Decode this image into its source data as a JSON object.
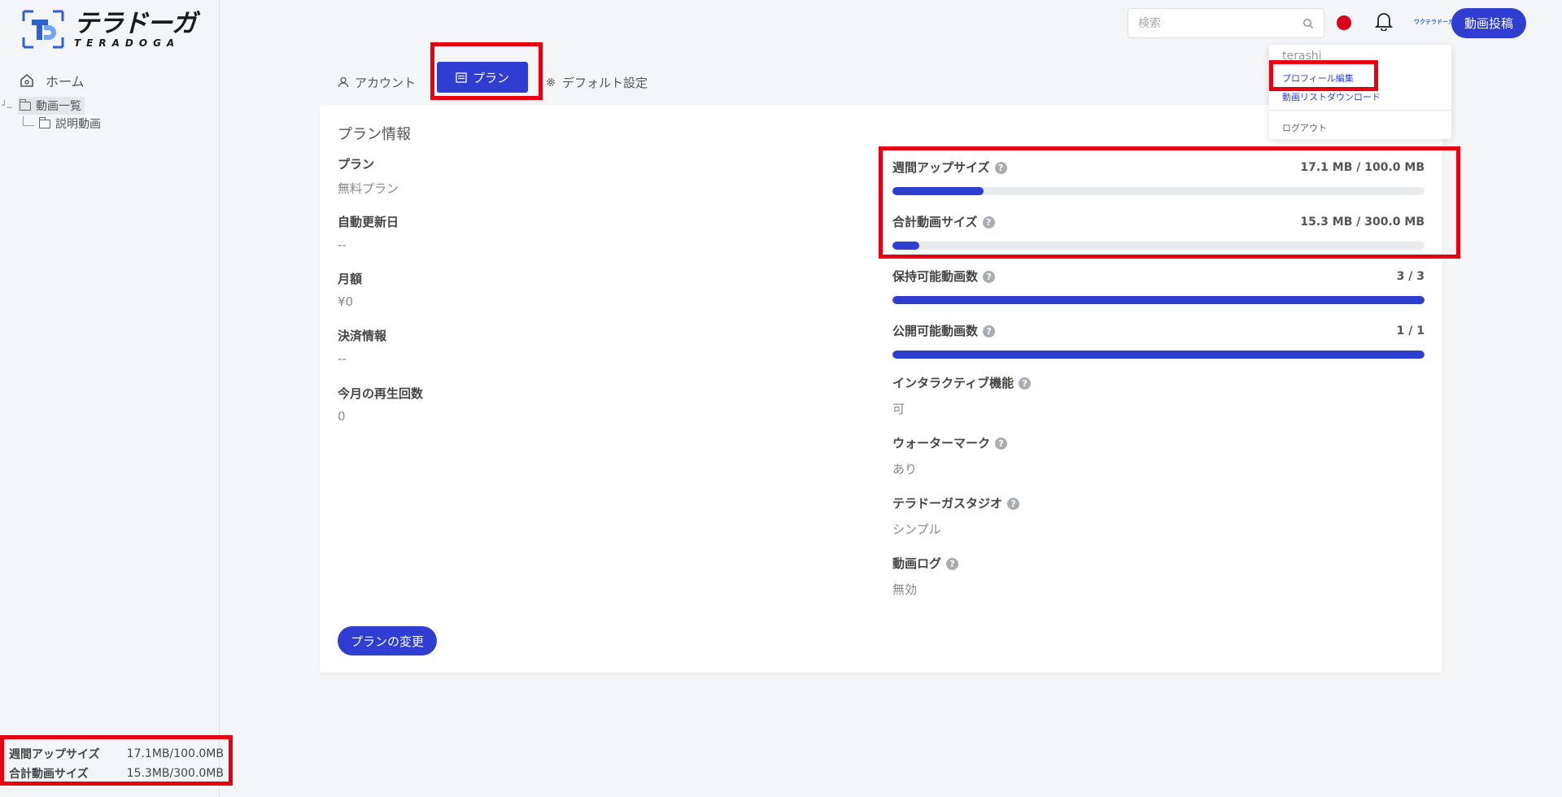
{
  "brand": {
    "name_jp": "テラドーガ",
    "name_en": "TERADOGA"
  },
  "sidebar": {
    "home_label": "ホーム",
    "tree": {
      "root_label": "動画一覧",
      "child_label": "説明動画"
    },
    "usage": [
      {
        "label": "週間アップサイズ",
        "value": "17.1MB/100.0MB"
      },
      {
        "label": "合計動画サイズ",
        "value": "15.3MB/300.0MB"
      }
    ]
  },
  "header": {
    "search_placeholder": "検索",
    "post_button": "動画投稿",
    "avatar_text": "ワクテラドーガ",
    "colors": {
      "flag": "#d8001a",
      "accent": "#2f3ed0"
    }
  },
  "dropdown": {
    "username": "terashi",
    "items": [
      "プロフィール編集",
      "動画リストダウンロード"
    ],
    "logout": "ログアウト"
  },
  "tabs": [
    {
      "label": "アカウント",
      "icon": "user-icon"
    },
    {
      "label": "プラン",
      "icon": "card-icon",
      "active": true
    },
    {
      "label": "デフォルト設定",
      "icon": "gear-icon"
    }
  ],
  "plan": {
    "title": "プラン情報",
    "info": [
      {
        "label": "プラン",
        "value": "無料プラン"
      },
      {
        "label": "自動更新日",
        "value": "--"
      },
      {
        "label": "月額",
        "value": "¥0"
      },
      {
        "label": "決済情報",
        "value": "--"
      },
      {
        "label": "今月の再生回数",
        "value": "0"
      }
    ],
    "meters": [
      {
        "label": "週間アップサイズ",
        "amount": "17.1 MB / 100.0 MB",
        "fraction": 0.171
      },
      {
        "label": "合計動画サイズ",
        "amount": "15.3 MB / 300.0 MB",
        "fraction": 0.051
      },
      {
        "label": "保持可能動画数",
        "amount": "3 / 3",
        "fraction": 1.0
      },
      {
        "label": "公開可能動画数",
        "amount": "1 / 1",
        "fraction": 1.0
      }
    ],
    "features": [
      {
        "label": "インタラクティブ機能",
        "value": "可"
      },
      {
        "label": "ウォーターマーク",
        "value": "あり"
      },
      {
        "label": "テラドーガスタジオ",
        "value": "シンプル"
      },
      {
        "label": "動画ログ",
        "value": "無効"
      }
    ],
    "help_glyph": "?",
    "change_button": "プランの変更"
  }
}
